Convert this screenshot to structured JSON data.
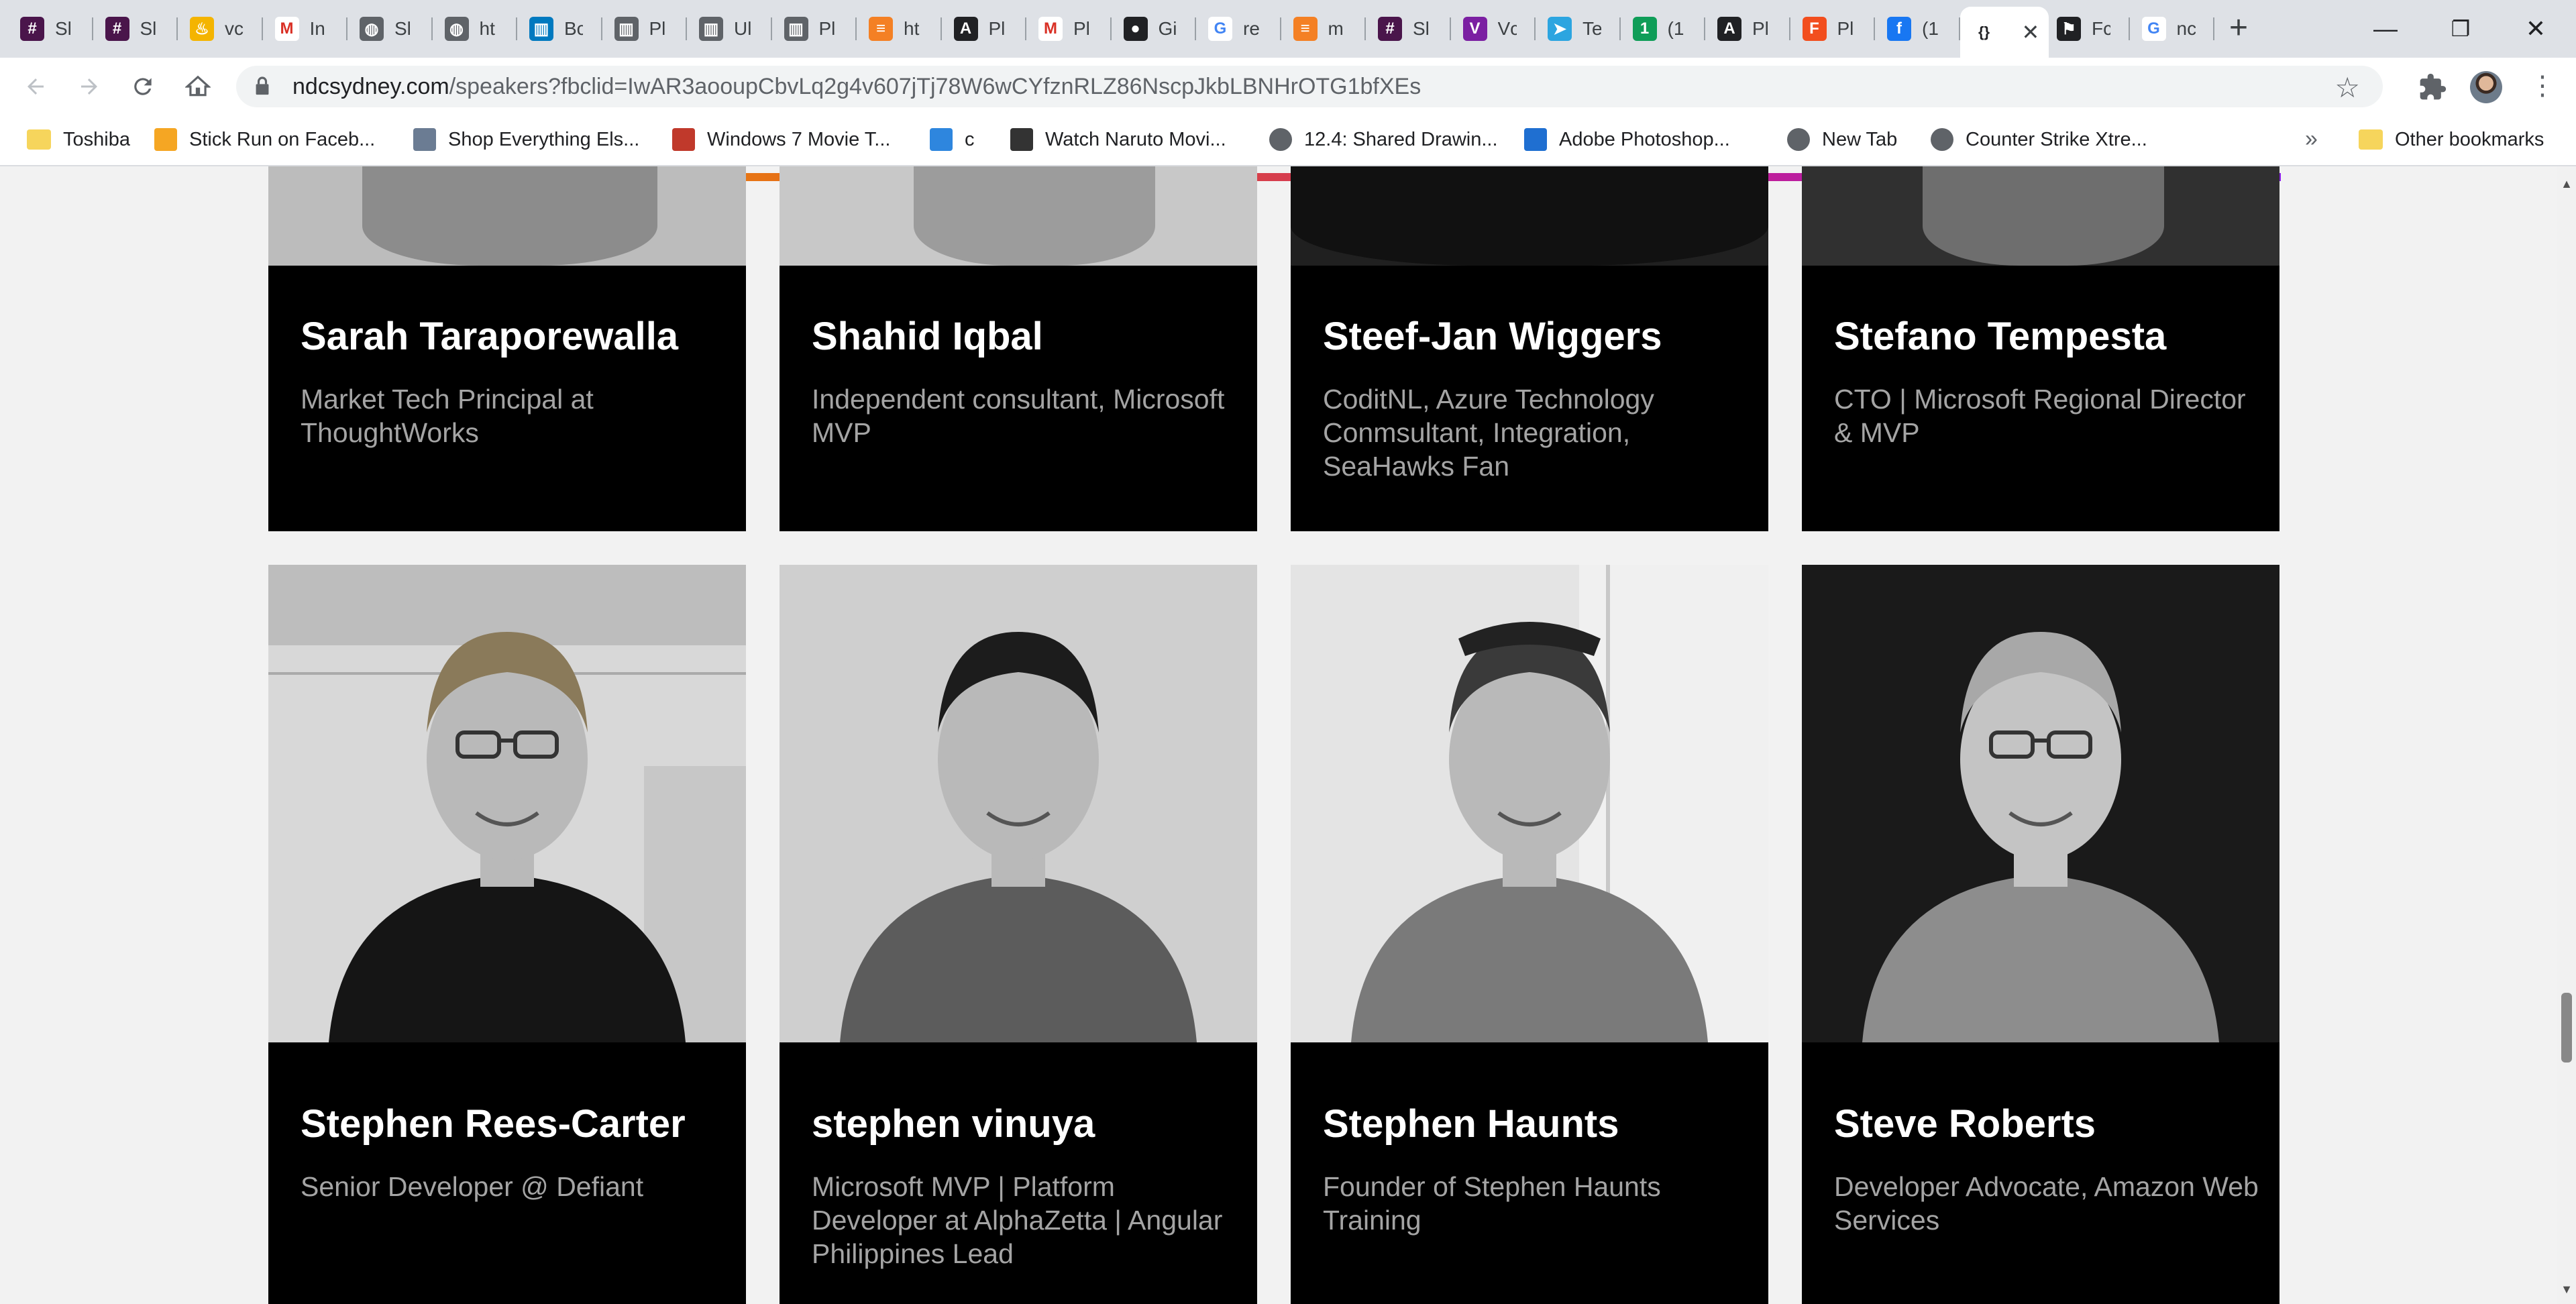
{
  "browser": {
    "tabs": [
      {
        "title": "Sl",
        "icon": "slack-icon",
        "color": "#4a154b"
      },
      {
        "title": "Sl",
        "icon": "slack-icon",
        "color": "#4a154b"
      },
      {
        "title": "vc",
        "icon": "flame-icon",
        "color": "#f4b400"
      },
      {
        "title": "In",
        "icon": "gmail-icon",
        "color": "#d93025"
      },
      {
        "title": "Sl",
        "icon": "globe-icon",
        "color": "#5f6368"
      },
      {
        "title": "ht",
        "icon": "globe-icon",
        "color": "#5f6368"
      },
      {
        "title": "Bc",
        "icon": "trello-icon",
        "color": "#0079bf"
      },
      {
        "title": "Pl",
        "icon": "trello-icon",
        "color": "#5f6368"
      },
      {
        "title": "Ul",
        "icon": "trello-icon",
        "color": "#5f6368"
      },
      {
        "title": "Pl",
        "icon": "trello-icon",
        "color": "#5f6368"
      },
      {
        "title": "ht",
        "icon": "stack-icon",
        "color": "#f48024"
      },
      {
        "title": "Pl",
        "icon": "angular-icon",
        "color": "#202124"
      },
      {
        "title": "Pl",
        "icon": "gmail-icon",
        "color": "#d93025"
      },
      {
        "title": "Gi",
        "icon": "github-icon",
        "color": "#202124"
      },
      {
        "title": "re",
        "icon": "google-icon",
        "color": "#4285f4"
      },
      {
        "title": "m",
        "icon": "stack-icon",
        "color": "#f48024"
      },
      {
        "title": "Sl",
        "icon": "slack-icon",
        "color": "#4a154b"
      },
      {
        "title": "Vc",
        "icon": "vote-icon",
        "color": "#7b1fa2"
      },
      {
        "title": "Te",
        "icon": "telegram-icon",
        "color": "#2ca5e0"
      },
      {
        "title": "(1",
        "icon": "one-icon",
        "color": "#0f9d58"
      },
      {
        "title": "Pl",
        "icon": "angular-icon",
        "color": "#202124"
      },
      {
        "title": "Pl",
        "icon": "figma-icon",
        "color": "#f24e1e"
      },
      {
        "title": "(1",
        "icon": "facebook-icon",
        "color": "#1877f2"
      },
      {
        "title": "",
        "icon": "code-braces-icon",
        "color": "#ffffff",
        "active": true
      },
      {
        "title": "Fc",
        "icon": "flag-icon",
        "color": "#202124"
      },
      {
        "title": "nc",
        "icon": "google-icon",
        "color": "#4285f4"
      }
    ],
    "address": {
      "domain": "ndcsydney.com",
      "path": "/speakers?fbclid=IwAR3aooupCbvLq2g4v607jTj78W6wCYfznRLZ86NscpJkbLBNHrOTG1bfXEs"
    },
    "bookmarks": [
      {
        "label": "Toshiba",
        "icon": "folder-icon"
      },
      {
        "label": "Stick Run on Faceb...",
        "icon": "stick-run-icon"
      },
      {
        "label": "Shop Everything Els...",
        "icon": "shop-icon"
      },
      {
        "label": "Windows 7 Movie T...",
        "icon": "windows-movie-icon"
      },
      {
        "label": "c",
        "icon": "c-icon"
      },
      {
        "label": "Watch Naruto Movi...",
        "icon": "naruto-icon"
      },
      {
        "label": "12.4: Shared Drawin...",
        "icon": "globe-icon"
      },
      {
        "label": "Adobe Photoshop...",
        "icon": "photoshop-icon"
      },
      {
        "label": "New Tab",
        "icon": "globe-icon"
      },
      {
        "label": "Counter Strike Xtre...",
        "icon": "globe-icon"
      }
    ],
    "other_bookmarks": "Other bookmarks",
    "more_bookmarks": "»",
    "new_tab": "+",
    "minimize": "—",
    "restore": "❐",
    "close": "✕"
  },
  "speakers": [
    {
      "name": "Sarah Taraporewalla",
      "role": "Market Tech Principal at ThoughtWorks"
    },
    {
      "name": "Shahid Iqbal",
      "role": "Independent consultant, Microsoft MVP"
    },
    {
      "name": "Steef-Jan Wiggers",
      "role": "CoditNL, Azure Technology Conmsultant, Integration, SeaHawks Fan"
    },
    {
      "name": "Stefano Tempesta",
      "role": "CTO | Microsoft Regional Director & MVP"
    },
    {
      "name": "Stephen Rees-Carter",
      "role": "Senior Developer @ Defiant"
    },
    {
      "name": "stephen vinuya",
      "role": "Microsoft MVP | Platform Developer at AlphaZetta | Angular Philippines Lead"
    },
    {
      "name": "Stephen Haunts",
      "role": "Founder of Stephen Haunts Training"
    },
    {
      "name": "Steve Roberts",
      "role": "Developer Advocate, Amazon Web Services"
    }
  ]
}
